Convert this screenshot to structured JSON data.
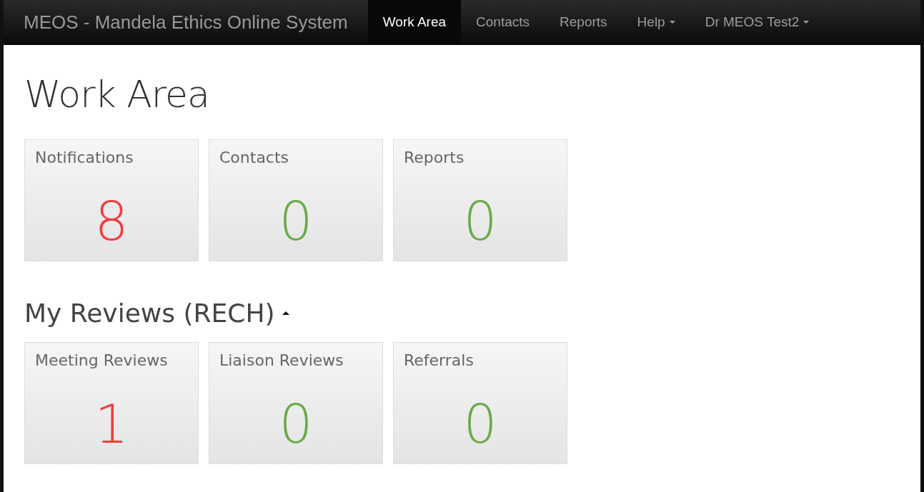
{
  "navbar": {
    "brand": "MEOS - Mandela Ethics Online System",
    "items": [
      {
        "label": "Work Area",
        "selected": true,
        "dropdown": false
      },
      {
        "label": "Contacts",
        "selected": false,
        "dropdown": false
      },
      {
        "label": "Reports",
        "selected": false,
        "dropdown": false
      },
      {
        "label": "Help",
        "selected": false,
        "dropdown": true
      },
      {
        "label": "Dr MEOS Test2",
        "selected": false,
        "dropdown": true
      }
    ]
  },
  "page_title": "Work Area",
  "summary_tiles": [
    {
      "label": "Notifications",
      "count": "8",
      "color": "#f03c3c"
    },
    {
      "label": "Contacts",
      "count": "0",
      "color": "#6aaa47"
    },
    {
      "label": "Reports",
      "count": "0",
      "color": "#6aaa47"
    }
  ],
  "reviews_section": {
    "heading": "My Reviews (RECH)",
    "expanded": true,
    "tiles": [
      {
        "label": "Meeting Reviews",
        "count": "1",
        "color": "#f03c3c"
      },
      {
        "label": "Liaison Reviews",
        "count": "0",
        "color": "#6aaa47"
      },
      {
        "label": "Referrals",
        "count": "0",
        "color": "#6aaa47"
      }
    ]
  }
}
